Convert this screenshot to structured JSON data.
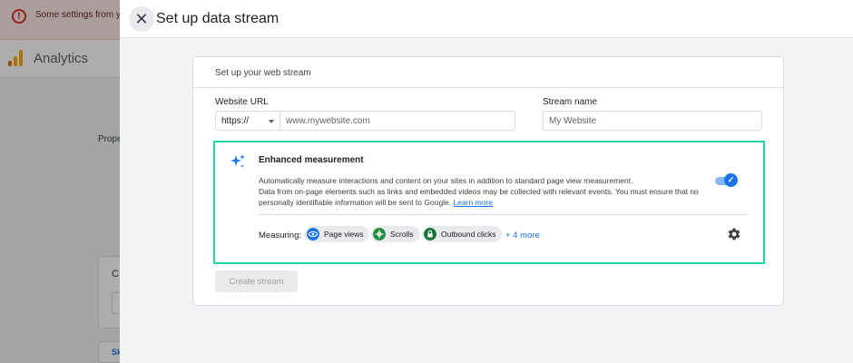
{
  "background": {
    "banner_text": "Some settings from your Assistant in the connected",
    "app_name": "Analytics",
    "side_text": "Prope",
    "card_initial": "C",
    "button_text": "Sk"
  },
  "panel": {
    "title": "Set up data stream",
    "close_icon": "close-icon"
  },
  "web_stream": {
    "title": "Set up your web stream",
    "website_url_label": "Website URL",
    "protocol_value": "https://",
    "website_url_placeholder": "www.mywebsite.com",
    "stream_name_label": "Stream name",
    "stream_name_placeholder": "My Website"
  },
  "enhanced_measurement": {
    "title": "Enhanced measurement",
    "description_line1": "Automatically measure interactions and content on your sites in addition to standard page view measurement.",
    "description_line2": "Data from on-page elements such as links and embedded videos may be collected with relevant events. You must ensure that no personally identifiable information will be sent to Google.",
    "learn_more": "Learn more",
    "enabled": true,
    "measuring_label": "Measuring:",
    "chips": [
      {
        "label": "Page views",
        "icon": "eye-icon",
        "color": "#1a73e8"
      },
      {
        "label": "Scrolls",
        "icon": "crosshair-icon",
        "color": "#1e8e3e"
      },
      {
        "label": "Outbound clicks",
        "icon": "lock-icon",
        "color": "#137333"
      }
    ],
    "more_link": "+ 4 more",
    "settings_icon": "gear-icon"
  },
  "actions": {
    "create_stream": "Create stream"
  },
  "colors": {
    "highlight": "#1ed6a4",
    "accent": "#1a73e8",
    "banner_bg": "#fce8e6",
    "error": "#d93025"
  }
}
